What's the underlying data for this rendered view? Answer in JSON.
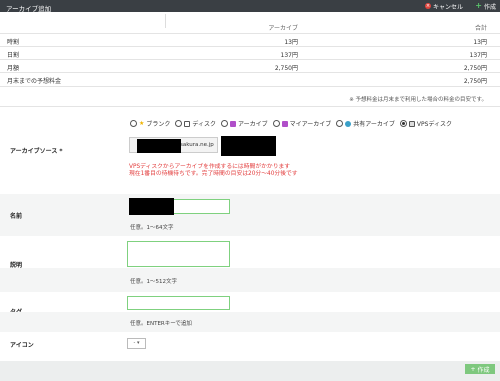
{
  "header": {
    "title": "アーカイブ追加",
    "cancel_label": "キャンセル",
    "create_label": "作成"
  },
  "pricing": {
    "col_archive": "アーカイブ",
    "col_total": "合計",
    "rows": [
      {
        "label": "時割",
        "archive": "13円",
        "total": "13円"
      },
      {
        "label": "日割",
        "archive": "137円",
        "total": "137円"
      },
      {
        "label": "月額",
        "archive": "2,750円",
        "total": "2,750円"
      },
      {
        "label": "月末までの予想料金",
        "archive": "",
        "total": "2,750円"
      }
    ],
    "note": "※ 予想料金は月末まで利用した場合の料金の目安です。"
  },
  "archive_source": {
    "label": "アーカイブソース *",
    "options": [
      {
        "label": "ブランク",
        "icon": "star-icon",
        "color": "#f0b400",
        "selected": false
      },
      {
        "label": "ディスク",
        "icon": "disk-icon",
        "color": "#555555",
        "selected": false
      },
      {
        "label": "アーカイブ",
        "icon": "archive-icon",
        "color": "#b04fc9",
        "selected": false
      },
      {
        "label": "マイアーカイブ",
        "icon": "my-archive-icon",
        "color": "#b04fc9",
        "selected": false
      },
      {
        "label": "共有アーカイブ",
        "icon": "shared-archive-icon",
        "color": "#3aa0c8",
        "selected": false
      },
      {
        "label": "VPSディスク",
        "icon": "vps-disk-icon",
        "color": "#555555",
        "selected": true
      }
    ],
    "server_fragment": "sakura.ne.jp",
    "warning_line1": "VPSディスクからアーカイブを作成するには時間がかかります",
    "warning_line2": "現在1番目の待機待ちです。完了時間の目安は20分～40分後です"
  },
  "name_field": {
    "label": "名前",
    "hint": "任意。1～64文字"
  },
  "description_field": {
    "label": "説明",
    "hint": "任意。1～512文字"
  },
  "tag_field": {
    "label": "タグ",
    "hint": "任意。ENTERキーで追加"
  },
  "icon_field": {
    "label": "アイコン",
    "select_value": "-"
  },
  "footer": {
    "create_label": "作成"
  }
}
